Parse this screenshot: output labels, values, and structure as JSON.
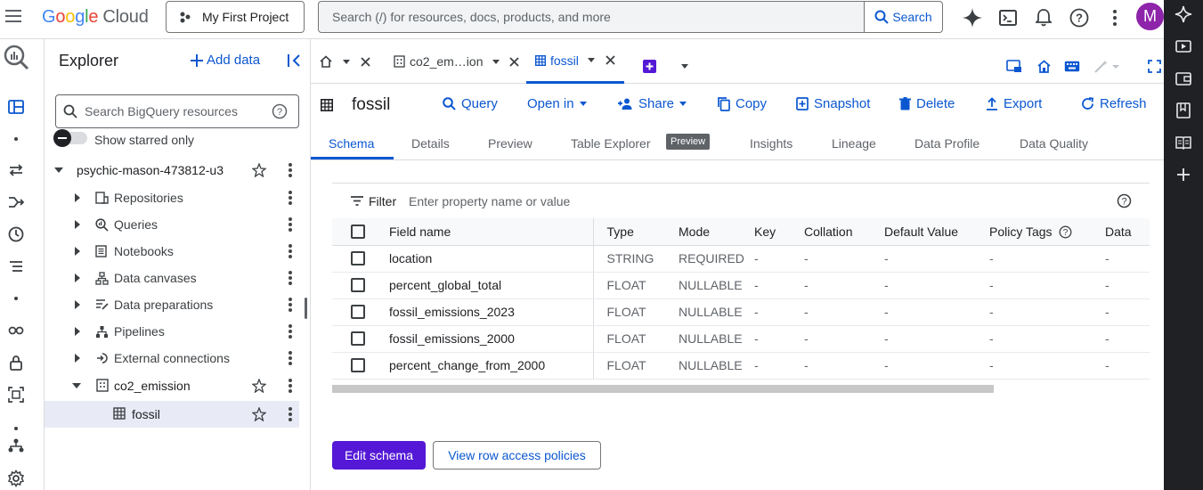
{
  "topbar": {
    "logo_google": [
      "G",
      "o",
      "o",
      "g",
      "l",
      "e"
    ],
    "logo_cloud": "Cloud",
    "project_label": "My First Project",
    "search_placeholder": "Search (/) for resources, docs, products, and more",
    "search_button": "Search",
    "avatar_letter": "M",
    "avatar_color": "#8e24aa"
  },
  "explorer": {
    "title": "Explorer",
    "add_data": "Add data",
    "search_placeholder": "Search BigQuery resources",
    "show_starred": "Show starred only",
    "project": "psychic-mason-473812-u3",
    "items": [
      {
        "label": "Repositories",
        "icon": "repository-icon"
      },
      {
        "label": "Queries",
        "icon": "query-icon"
      },
      {
        "label": "Notebooks",
        "icon": "notebook-icon"
      },
      {
        "label": "Data canvases",
        "icon": "canvas-icon"
      },
      {
        "label": "Data preparations",
        "icon": "data-prep-icon"
      },
      {
        "label": "Pipelines",
        "icon": "pipeline-icon"
      },
      {
        "label": "External connections",
        "icon": "connection-icon"
      }
    ],
    "dataset": "co2_emission",
    "table": "fossil"
  },
  "tabs": {
    "dataset_tab": "co2_em…ion",
    "table_tab": "fossil"
  },
  "toolbar": {
    "title": "fossil",
    "query": "Query",
    "open_in": "Open in",
    "share": "Share",
    "copy": "Copy",
    "snapshot": "Snapshot",
    "delete": "Delete",
    "export": "Export",
    "refresh": "Refresh"
  },
  "subtabs": {
    "schema": "Schema",
    "details": "Details",
    "preview": "Preview",
    "table_explorer": "Table Explorer",
    "preview_badge": "Preview",
    "insights": "Insights",
    "lineage": "Lineage",
    "data_profile": "Data Profile",
    "data_quality": "Data Quality"
  },
  "schema": {
    "filter_label": "Filter",
    "filter_placeholder": "Enter property name or value",
    "columns": [
      "Field name",
      "Type",
      "Mode",
      "Key",
      "Collation",
      "Default Value",
      "Policy Tags",
      "Data"
    ],
    "rows": [
      {
        "name": "location",
        "type": "STRING",
        "mode": "REQUIRED",
        "key": "-",
        "collation": "-",
        "default": "-",
        "policy": "-",
        "data": "-"
      },
      {
        "name": "percent_global_total",
        "type": "FLOAT",
        "mode": "NULLABLE",
        "key": "-",
        "collation": "-",
        "default": "-",
        "policy": "-",
        "data": "-"
      },
      {
        "name": "fossil_emissions_2023",
        "type": "FLOAT",
        "mode": "NULLABLE",
        "key": "-",
        "collation": "-",
        "default": "-",
        "policy": "-",
        "data": "-"
      },
      {
        "name": "fossil_emissions_2000",
        "type": "FLOAT",
        "mode": "NULLABLE",
        "key": "-",
        "collation": "-",
        "default": "-",
        "policy": "-",
        "data": "-"
      },
      {
        "name": "percent_change_from_2000",
        "type": "FLOAT",
        "mode": "NULLABLE",
        "key": "-",
        "collation": "-",
        "default": "-",
        "policy": "-",
        "data": "-"
      }
    ],
    "edit_schema": "Edit schema",
    "row_access": "View row access policies"
  },
  "colors": {
    "accent": "#0b57d0",
    "primary_button": "#5418d6",
    "selected_row": "#e8eaf6",
    "dark_rail": "#202124"
  }
}
